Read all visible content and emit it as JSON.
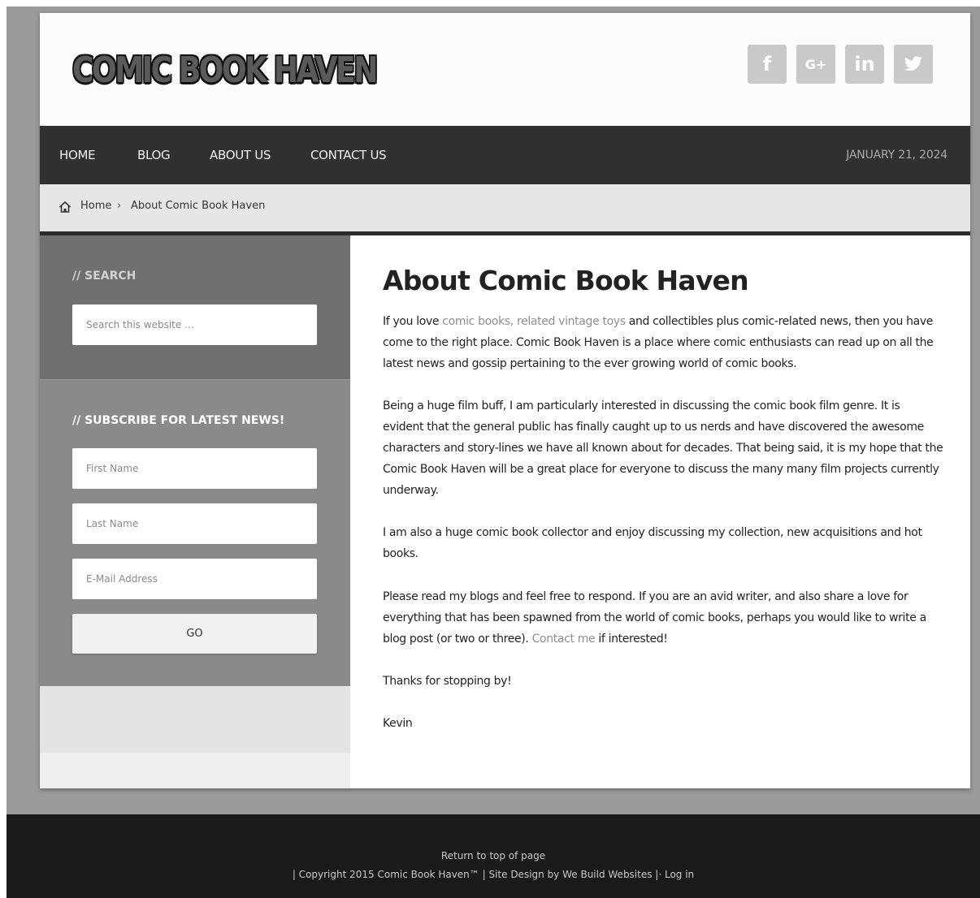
{
  "site": {
    "logo_text": "COMIC BOOK HAVEN",
    "social": [
      {
        "icon": "facebook-icon",
        "glyph": "f"
      },
      {
        "icon": "google-plus-icon",
        "glyph": "G+"
      },
      {
        "icon": "linkedin-icon",
        "glyph": "in"
      },
      {
        "icon": "twitter-icon",
        "glyph": "t"
      }
    ]
  },
  "nav": {
    "items": [
      "HOME",
      "BLOG",
      "ABOUT US",
      "CONTACT US"
    ],
    "date": "JANUARY 21, 2024"
  },
  "breadcrumb": {
    "home": "Home",
    "separator": "›",
    "current": "About Comic Book Haven"
  },
  "sidebar": {
    "search": {
      "title": "//  SEARCH",
      "placeholder": "Search this website …"
    },
    "subscribe": {
      "title": "//  SUBSCRIBE FOR LATEST NEWS!",
      "first_name": "First Name",
      "last_name": "Last Name",
      "email": "E-Mail Address",
      "button": "GO"
    }
  },
  "content": {
    "title": "About Comic Book Haven",
    "p1": {
      "before": "If you love ",
      "link": "comic books, related vintage toys",
      "after": " and collectibles plus comic-related news, then you have come to the right place.  Comic Book Haven is  a place where comic enthusiasts can read up on all the latest news and gossip pertaining to the ever growing world of comic books."
    },
    "p2": "Being a huge film buff, I am particularly interested in discussing the comic book film genre.  It is evident that the general public has finally caught up to us nerds and have discovered the awesome characters and story-lines we have all known about for decades.  That being said, it is my hope that the Comic Book Haven will be a great place for everyone to discuss the many many film projects currently underway.",
    "p3": "I am also a huge comic book collector and enjoy discussing my collection, new acquisitions and hot books.",
    "p4": {
      "before": "Please read my blogs and feel free to respond.  If you are an avid writer, and also share a love for everything that has been spawned from the world of comic books, perhaps you would like to write a blog post (or two or three).  ",
      "link": "Contact me",
      "after": " if interested!"
    },
    "p5": "Thanks for stopping by!",
    "p6": "Kevin"
  },
  "footer": {
    "top_link": "Return to top of page",
    "copyright": "| Copyright 2015 Comic Book Haven™ | Site Design by We Build Websites |· Log in"
  }
}
